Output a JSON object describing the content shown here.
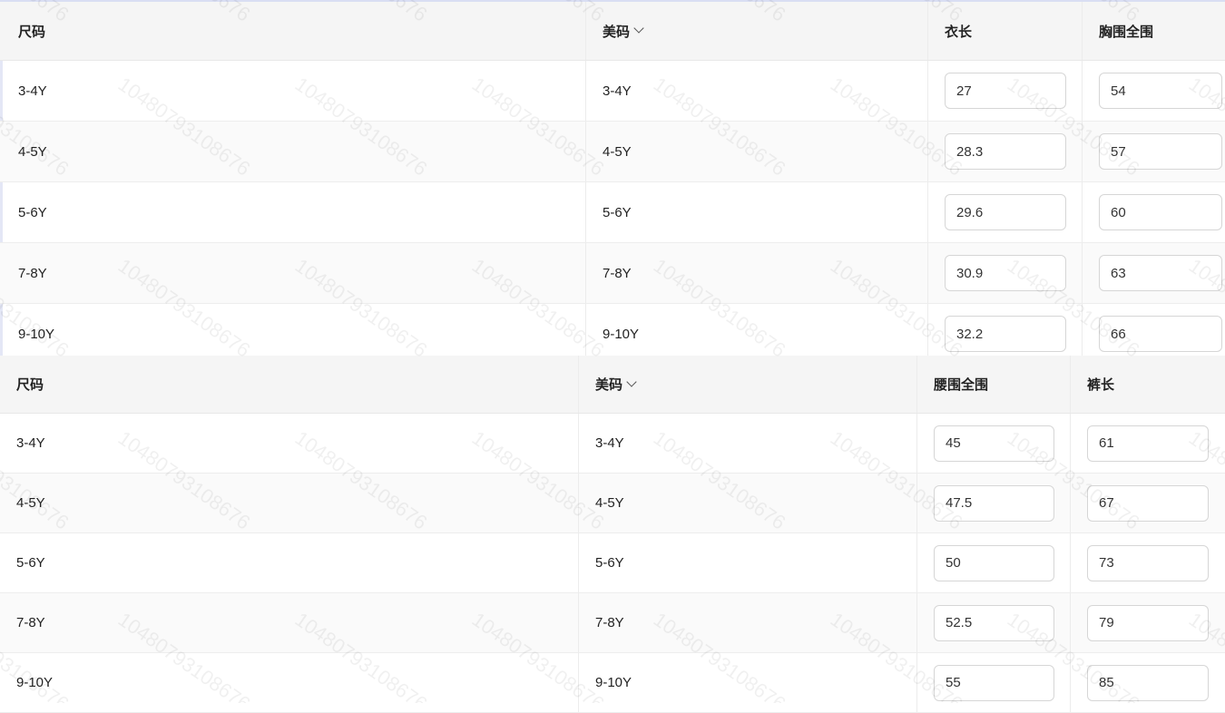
{
  "watermark": "10480793108676",
  "table_top": {
    "headers": [
      "尺码",
      "美码",
      "衣长",
      "胸围全围"
    ],
    "rows": [
      {
        "size": "3-4Y",
        "us": "3-4Y",
        "v1": "27",
        "v2": "54"
      },
      {
        "size": "4-5Y",
        "us": "4-5Y",
        "v1": "28.3",
        "v2": "57"
      },
      {
        "size": "5-6Y",
        "us": "5-6Y",
        "v1": "29.6",
        "v2": "60"
      },
      {
        "size": "7-8Y",
        "us": "7-8Y",
        "v1": "30.9",
        "v2": "63"
      },
      {
        "size": "9-10Y",
        "us": "9-10Y",
        "v1": "32.2",
        "v2": "66"
      }
    ]
  },
  "table_bottom": {
    "headers": [
      "尺码",
      "美码",
      "腰围全围",
      "裤长"
    ],
    "rows": [
      {
        "size": "3-4Y",
        "us": "3-4Y",
        "v1": "45",
        "v2": "61"
      },
      {
        "size": "4-5Y",
        "us": "4-5Y",
        "v1": "47.5",
        "v2": "67"
      },
      {
        "size": "5-6Y",
        "us": "5-6Y",
        "v1": "50",
        "v2": "73"
      },
      {
        "size": "7-8Y",
        "us": "7-8Y",
        "v1": "52.5",
        "v2": "79"
      },
      {
        "size": "9-10Y",
        "us": "9-10Y",
        "v1": "55",
        "v2": "85"
      }
    ]
  },
  "icons": {
    "sort": "chevron-down-icon"
  }
}
